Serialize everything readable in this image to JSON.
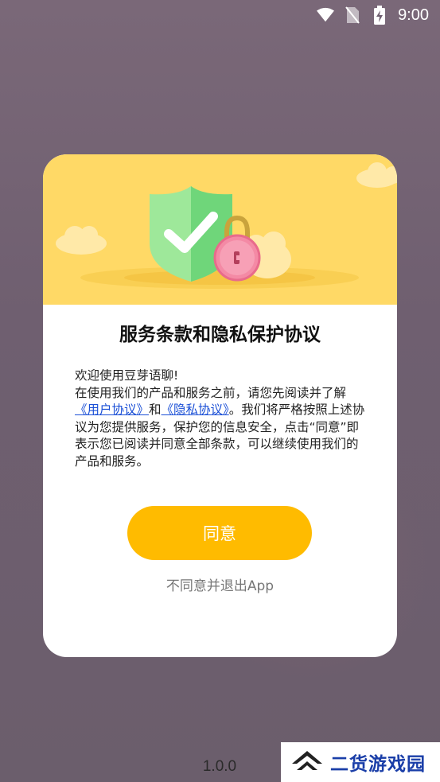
{
  "status_bar": {
    "time": "9:00",
    "icons": [
      "wifi-icon",
      "no-sim-icon",
      "battery-charging-icon"
    ]
  },
  "dialog": {
    "title": "服务条款和隐私保护协议",
    "body": {
      "line1": "欢迎使用豆芽语聊!",
      "segment_before": "在使用我们的产品和服务之前，请您先阅读并了解",
      "user_agreement_link": "《用户协议》",
      "and_text": "和",
      "privacy_link": "《隐私协议》",
      "segment_after": "。我们将严格按照上述协议为您提供服务，保护您的信息安全，点击“同意”即表示您已阅读并同意全部条款，可以继续使用我们的产品和服务。"
    },
    "agree_label": "同意",
    "disagree_label": "不同意并退出App",
    "colors": {
      "banner": "#ffd966",
      "button": "#ffbb00",
      "link": "#1a4fd6"
    }
  },
  "version": "1.0.0",
  "watermark": {
    "text": "二货游戏园"
  }
}
